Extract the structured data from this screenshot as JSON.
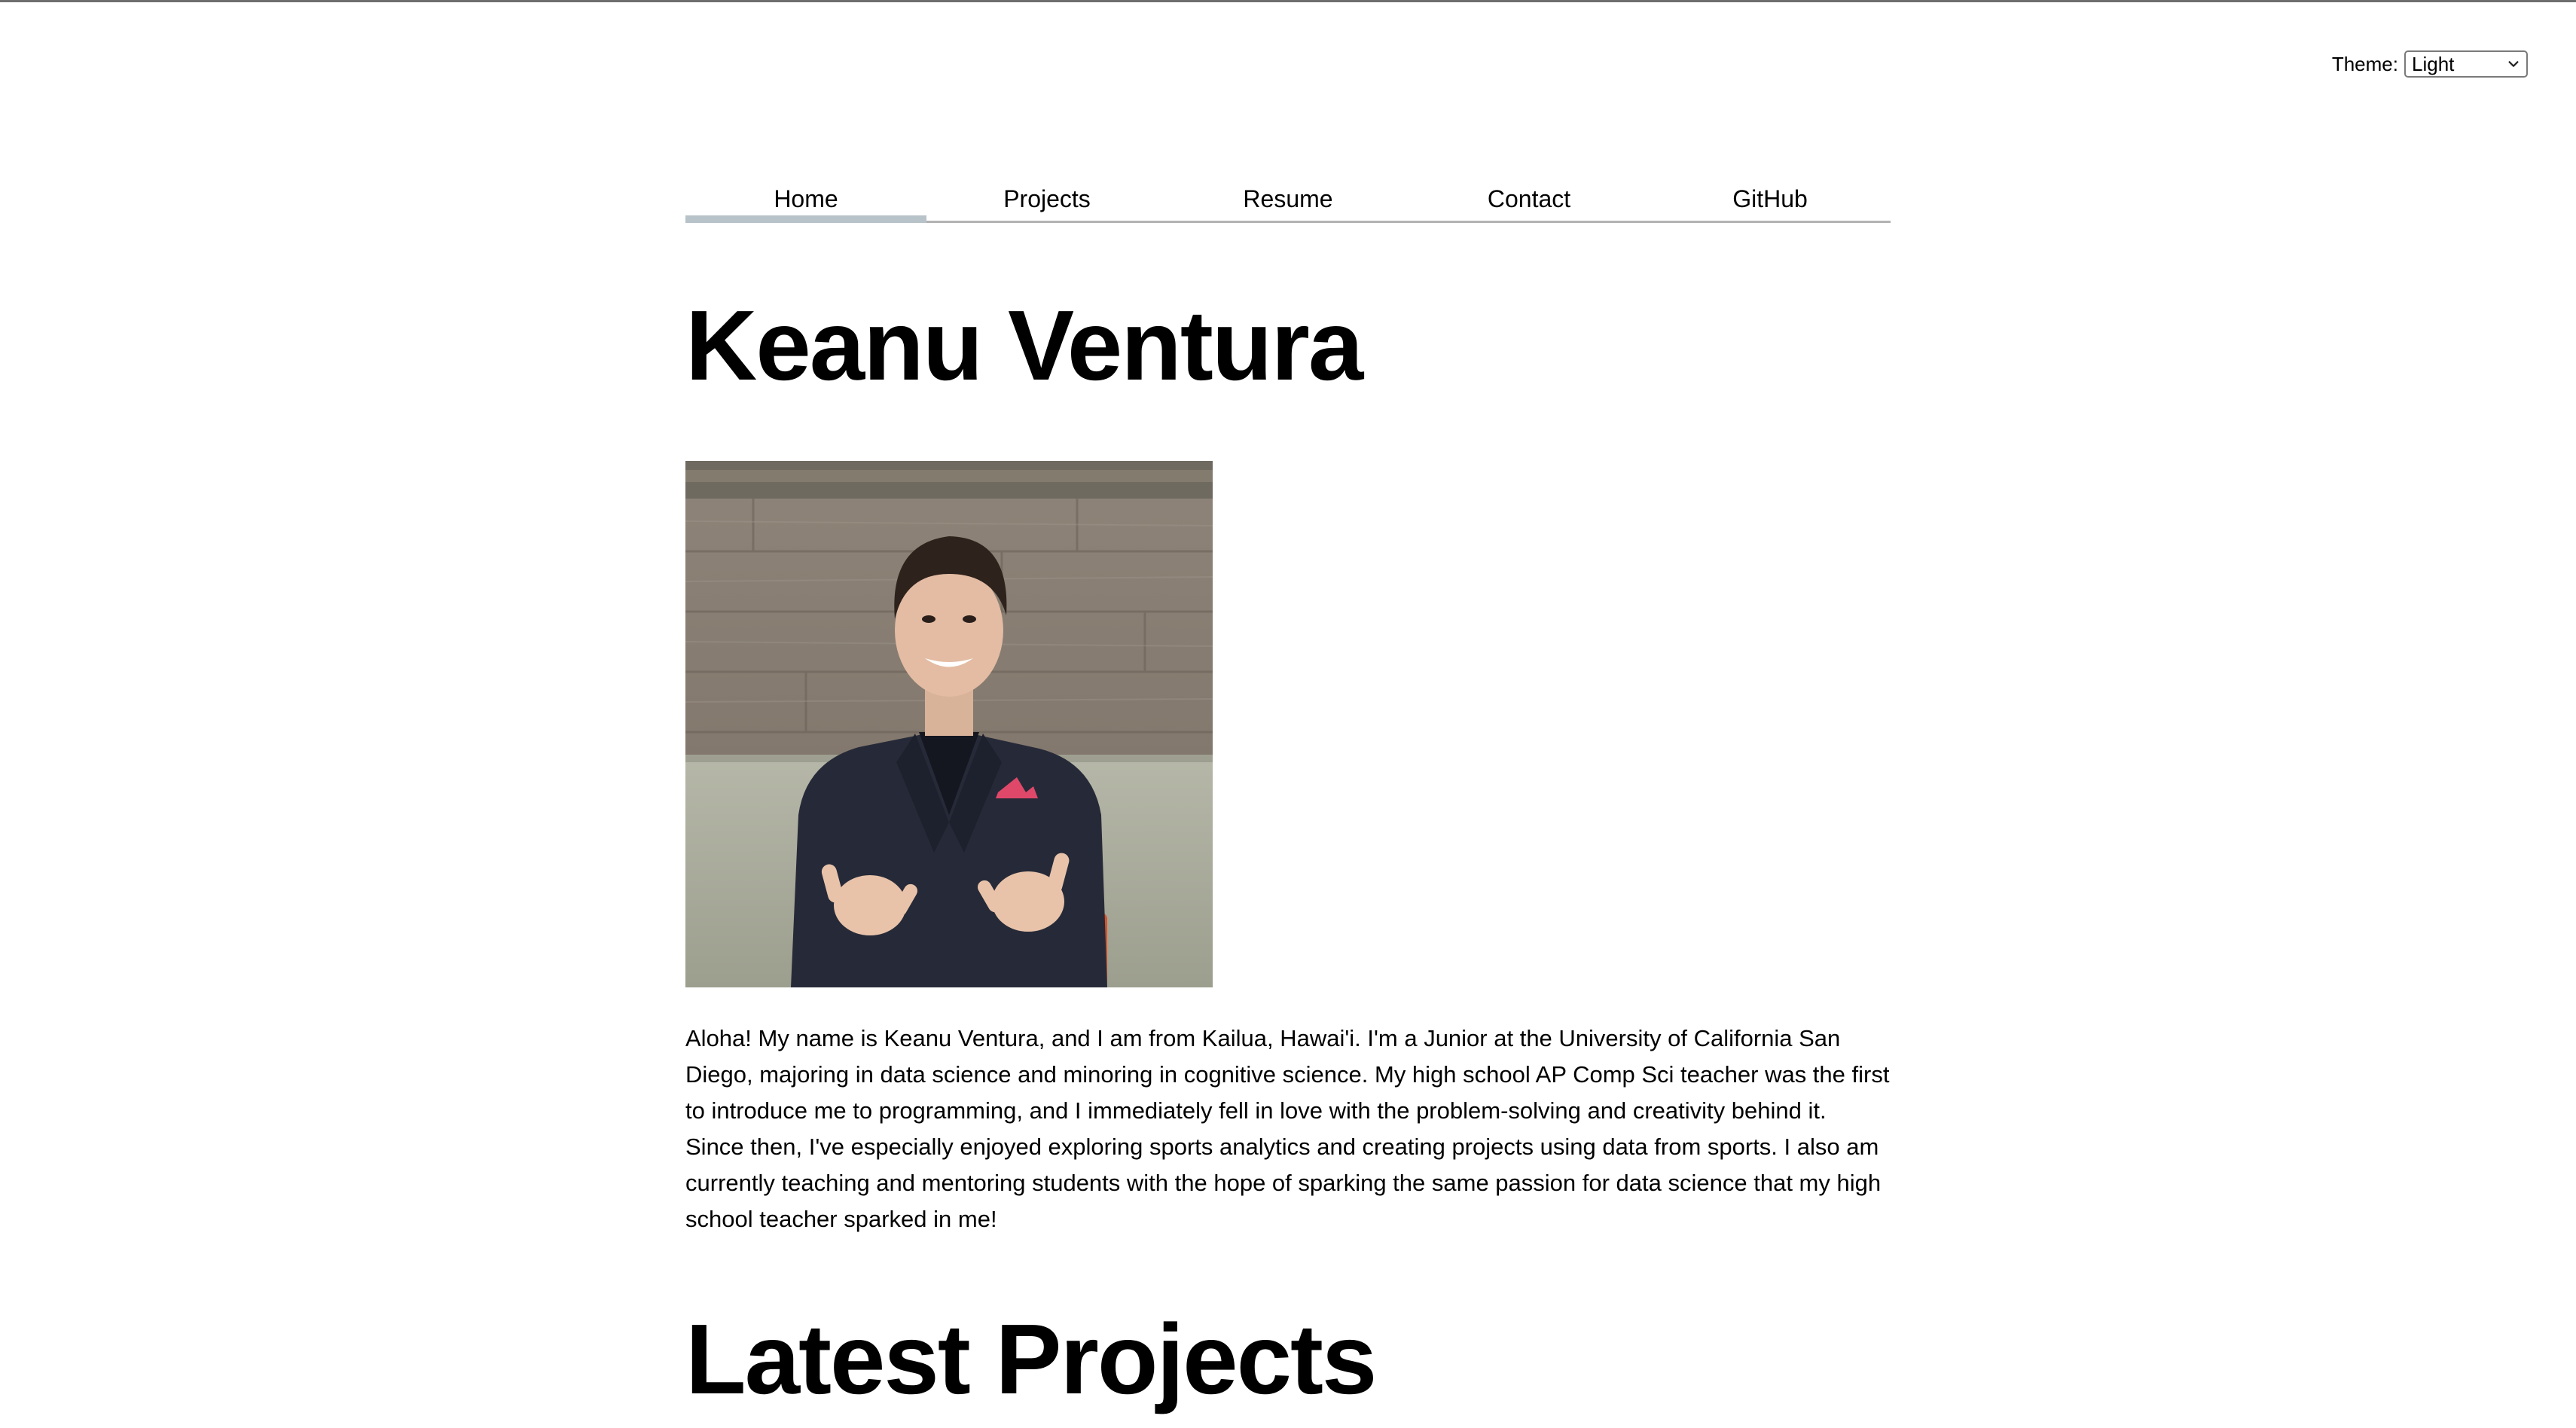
{
  "theme": {
    "label": "Theme:",
    "selected": "Light"
  },
  "nav": {
    "items": [
      {
        "label": "Home",
        "active": true
      },
      {
        "label": "Projects"
      },
      {
        "label": "Resume"
      },
      {
        "label": "Contact"
      },
      {
        "label": "GitHub"
      }
    ]
  },
  "header": {
    "title": "Keanu Ventura"
  },
  "bio": {
    "text": "Aloha! My name is Keanu Ventura, and I am from Kailua, Hawai'i. I'm a Junior at the University of California San Diego, majoring in data science and minoring in cognitive science. My high school AP Comp Sci teacher was the first to introduce me to programming, and I immediately fell in love with the problem-solving and creativity behind it. Since then, I've especially enjoyed exploring sports analytics and creating projects using data from sports. I also am currently teaching and mentoring students with the hope of sparking the same passion for data science that my high school teacher sparked in me!"
  },
  "sections": {
    "latest_projects_title": "Latest Projects"
  }
}
